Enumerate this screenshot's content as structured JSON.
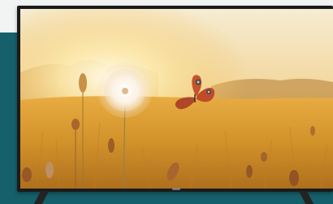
{
  "scene": {
    "product": "tv-display",
    "screen_image": "dandelion-butterfly-sunset-meadow",
    "colors": {
      "backdrop": "#15606a",
      "bezel": "#1b1b1c",
      "page": "#f2f4f4",
      "sky_top": "#f8eed4",
      "sun_glow": "#fff3c4",
      "meadow": "#d89622",
      "butterfly_wing": "#c2461c"
    }
  }
}
